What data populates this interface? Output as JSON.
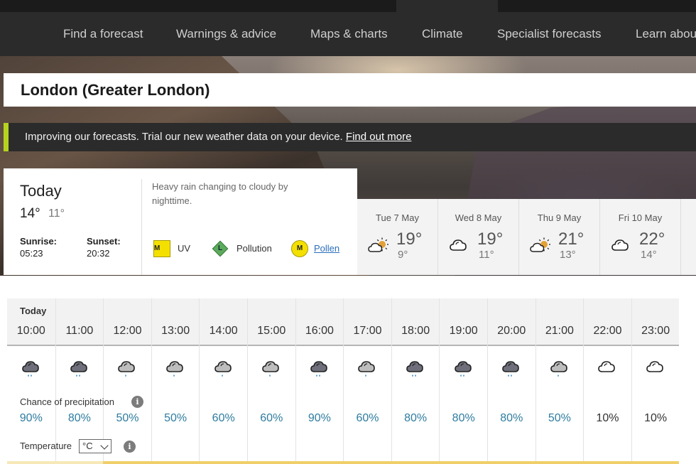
{
  "nav": {
    "items": [
      {
        "label": "Find a forecast"
      },
      {
        "label": "Warnings & advice"
      },
      {
        "label": "Maps & charts"
      },
      {
        "label": "Climate"
      },
      {
        "label": "Specialist forecasts"
      },
      {
        "label": "Learn about"
      }
    ]
  },
  "location": {
    "title": "London (Greater London)"
  },
  "banner": {
    "text": "Improving our forecasts. Trial our new weather data on your device.",
    "link": "Find out more",
    "accent_color": "#b6d31f"
  },
  "today": {
    "label": "Today",
    "high": "14°",
    "low": "11°",
    "sunrise_label": "Sunrise:",
    "sunrise": "05:23",
    "sunset_label": "Sunset:",
    "sunset": "20:32",
    "summary": "Heavy rain changing to cloudy by nighttime.",
    "uv": {
      "level": "M",
      "label": "UV"
    },
    "pollution": {
      "level": "L",
      "label": "Pollution"
    },
    "pollen": {
      "level": "M",
      "label": "Pollen"
    }
  },
  "days": [
    {
      "date": "Tue 7 May",
      "icon": "sunny-intervals-icon",
      "high": "19°",
      "low": "9°"
    },
    {
      "date": "Wed 8 May",
      "icon": "cloudy-icon",
      "high": "19°",
      "low": "11°"
    },
    {
      "date": "Thu 9 May",
      "icon": "sunny-intervals-icon",
      "high": "21°",
      "low": "13°"
    },
    {
      "date": "Fri 10 May",
      "icon": "cloudy-icon",
      "high": "22°",
      "low": "14°"
    }
  ],
  "hourly": {
    "day_label": "Today",
    "precip_label": "Chance of precipitation",
    "temp_label": "Temperature",
    "unit": "°C",
    "hours": [
      {
        "time": "10:00",
        "icon": "heavy-rain-icon",
        "precip": "90%"
      },
      {
        "time": "11:00",
        "icon": "heavy-rain-icon",
        "precip": "80%"
      },
      {
        "time": "12:00",
        "icon": "light-rain-icon",
        "precip": "50%"
      },
      {
        "time": "13:00",
        "icon": "light-rain-icon",
        "precip": "50%"
      },
      {
        "time": "14:00",
        "icon": "light-rain-icon",
        "precip": "60%"
      },
      {
        "time": "15:00",
        "icon": "light-rain-icon",
        "precip": "60%"
      },
      {
        "time": "16:00",
        "icon": "heavy-rain-icon",
        "precip": "90%"
      },
      {
        "time": "17:00",
        "icon": "light-rain-icon",
        "precip": "60%"
      },
      {
        "time": "18:00",
        "icon": "heavy-rain-icon",
        "precip": "80%"
      },
      {
        "time": "19:00",
        "icon": "heavy-rain-icon",
        "precip": "80%"
      },
      {
        "time": "20:00",
        "icon": "heavy-rain-icon",
        "precip": "80%"
      },
      {
        "time": "21:00",
        "icon": "light-rain-icon",
        "precip": "50%"
      },
      {
        "time": "22:00",
        "icon": "cloudy-icon",
        "precip": "10%"
      },
      {
        "time": "23:00",
        "icon": "cloudy-icon",
        "precip": "10%"
      }
    ]
  },
  "colors": {
    "precip_high": "#2e7ca0",
    "precip_low": "#333333",
    "uv_badge": "#f4e000",
    "pollution_badge": "#5cab5c"
  }
}
